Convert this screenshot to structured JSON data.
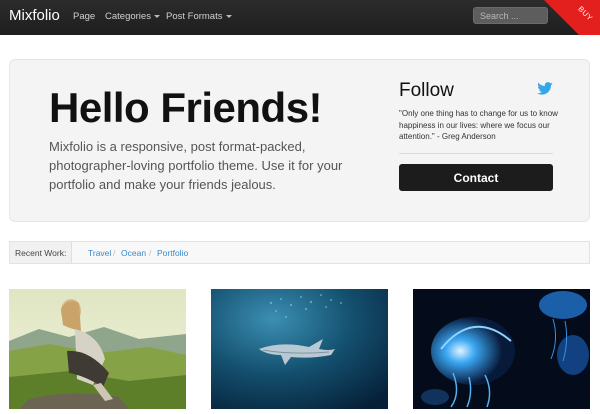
{
  "navbar": {
    "brand": "Mixfolio",
    "items": [
      {
        "label": "Page",
        "has_caret": false
      },
      {
        "label": "Categories",
        "has_caret": true
      },
      {
        "label": "Post Formats",
        "has_caret": true
      }
    ],
    "search_placeholder": "Search ...",
    "buy_label": "BUY"
  },
  "hero": {
    "title": "Hello Friends!",
    "text": "Mixfolio is a responsive, post format-packed, photographer-loving portfolio theme. Use it for your portfolio and make your friends jealous.",
    "follow_title": "Follow",
    "quote": "\"Only one thing has to change for us to know happiness in our lives: where we focus our attention.\" - Greg Anderson",
    "contact_label": "Contact"
  },
  "recent": {
    "label": "Recent Work:",
    "crumbs": [
      "Travel",
      "Ocean",
      "Portfolio"
    ]
  },
  "colors": {
    "navbar": "#222222",
    "ribbon": "#e4201f",
    "link": "#3a87c8",
    "button": "#1c1c1c",
    "twitter": "#35a7e8"
  },
  "icons": {
    "twitter": "twitter-bird-icon",
    "caret": "chevron-down-icon"
  },
  "thumbnails": [
    {
      "subject": "woman-sitting-on-hill"
    },
    {
      "subject": "shark-underwater"
    },
    {
      "subject": "glowing-jellyfish"
    }
  ]
}
